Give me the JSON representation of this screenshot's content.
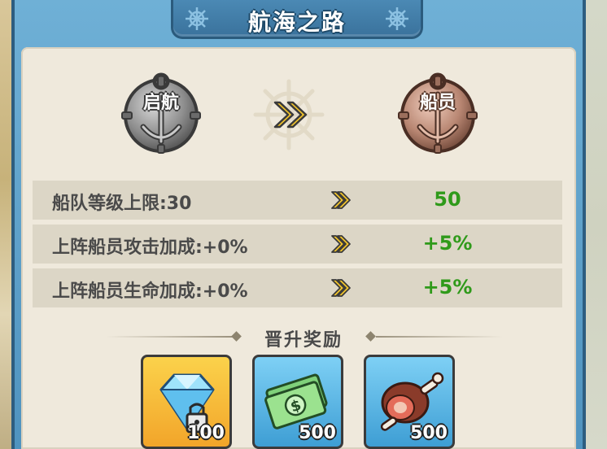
{
  "header": {
    "title": "航海之路"
  },
  "rank": {
    "current_label": "启航",
    "next_label": "船员"
  },
  "stats": [
    {
      "label": "船队等级上限:30",
      "value": "50"
    },
    {
      "label": "上阵船员攻击加成:+0%",
      "value": "+5%"
    },
    {
      "label": "上阵船员生命加成:+0%",
      "value": "+5%"
    }
  ],
  "rewards": {
    "title": "晋升奖励",
    "items": [
      {
        "icon": "locked-diamond-icon",
        "count": "100",
        "frame": "gold"
      },
      {
        "icon": "cash-stack-icon",
        "count": "500",
        "frame": "blue"
      },
      {
        "icon": "meat-icon",
        "count": "500",
        "frame": "blue"
      }
    ]
  },
  "colors": {
    "value_green": "#2f9a1a",
    "arrow_yellow": "#f2c42b",
    "panel": "#efe9dc",
    "row": "#dcd6c6"
  }
}
